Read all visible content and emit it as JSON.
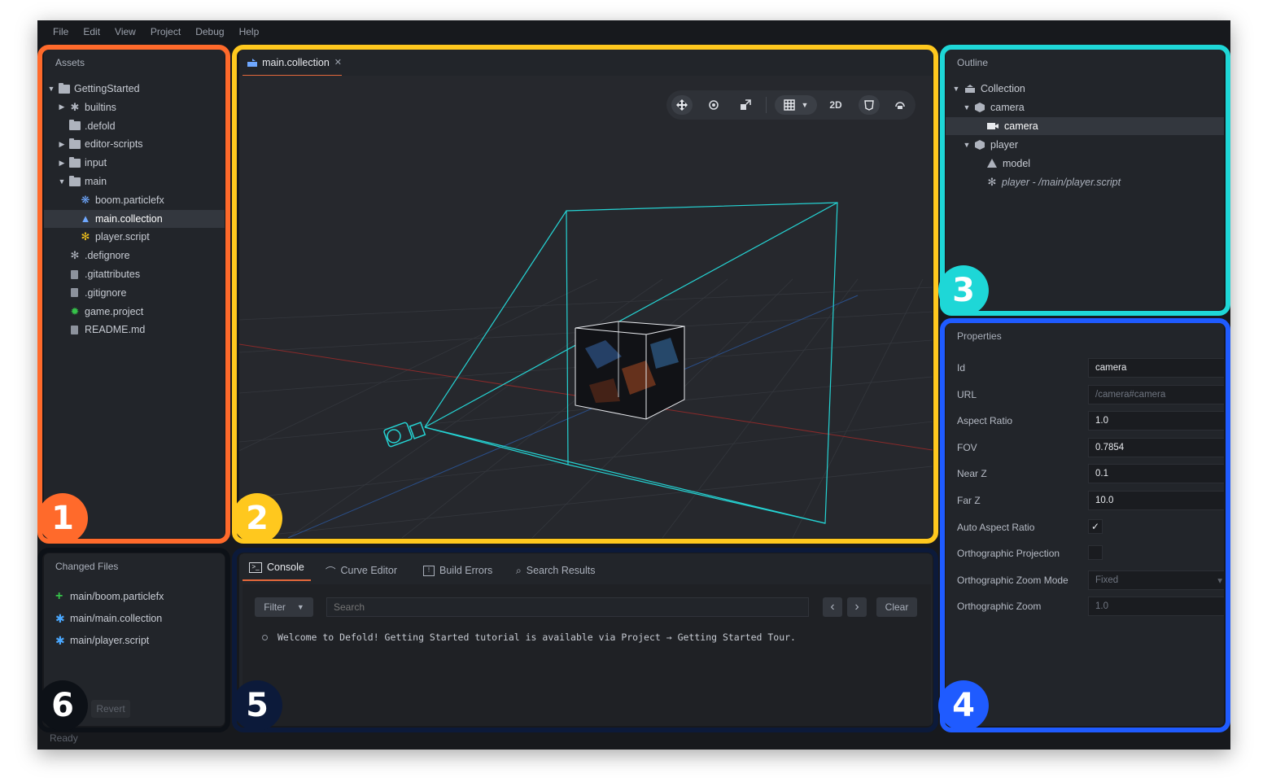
{
  "menu": [
    "File",
    "Edit",
    "View",
    "Project",
    "Debug",
    "Help"
  ],
  "assets": {
    "title": "Assets",
    "items": [
      {
        "label": "GettingStarted",
        "icon": "folder-icon",
        "toggle": "▼"
      },
      {
        "label": "builtins",
        "icon": "puzzle-icon",
        "toggle": "▶"
      },
      {
        "label": ".defold",
        "icon": "folder-icon",
        "toggle": ""
      },
      {
        "label": "editor-scripts",
        "icon": "folder-icon",
        "toggle": "▶"
      },
      {
        "label": "input",
        "icon": "folder-icon",
        "toggle": "▶"
      },
      {
        "label": "main",
        "icon": "folder-icon",
        "toggle": "▼"
      },
      {
        "label": "boom.particlefx",
        "icon": "particlefx-icon",
        "toggle": ""
      },
      {
        "label": "main.collection",
        "icon": "collection-icon",
        "toggle": ""
      },
      {
        "label": "player.script",
        "icon": "script-icon",
        "toggle": ""
      },
      {
        "label": ".defignore",
        "icon": "gear-icon",
        "toggle": ""
      },
      {
        "label": ".gitattributes",
        "icon": "file-icon",
        "toggle": ""
      },
      {
        "label": ".gitignore",
        "icon": "file-icon",
        "toggle": ""
      },
      {
        "label": "game.project",
        "icon": "project-gear-icon",
        "toggle": ""
      },
      {
        "label": "README.md",
        "icon": "file-icon",
        "toggle": ""
      }
    ]
  },
  "editor": {
    "tab_label": "main.collection",
    "tab_close": "✕",
    "toolbar": {
      "mode_2d": "2D"
    }
  },
  "outline": {
    "title": "Outline",
    "items": [
      {
        "label": "Collection",
        "toggle": "▼"
      },
      {
        "label": "camera",
        "toggle": "▼"
      },
      {
        "label": "camera",
        "toggle": ""
      },
      {
        "label": "player",
        "toggle": "▼"
      },
      {
        "label": "model",
        "toggle": ""
      },
      {
        "label": "player - /main/player.script",
        "toggle": ""
      }
    ]
  },
  "properties": {
    "title": "Properties",
    "rows": [
      {
        "label": "Id",
        "value": "camera",
        "readonly": false
      },
      {
        "label": "URL",
        "value": "/camera#camera",
        "readonly": true
      },
      {
        "label": "Aspect Ratio",
        "value": "1.0",
        "readonly": false
      },
      {
        "label": "FOV",
        "value": "0.7854",
        "readonly": false
      },
      {
        "label": "Near Z",
        "value": "0.1",
        "readonly": false
      },
      {
        "label": "Far Z",
        "value": "10.0",
        "readonly": false
      },
      {
        "label": "Auto Aspect Ratio",
        "value": "",
        "readonly": false
      },
      {
        "label": "Orthographic Projection",
        "value": "",
        "readonly": false
      },
      {
        "label": "Orthographic Zoom Mode",
        "value": "Fixed",
        "readonly": true
      },
      {
        "label": "Orthographic Zoom",
        "value": "1.0",
        "readonly": true
      }
    ],
    "auto_aspect_checked": true,
    "ortho_projection_checked": false
  },
  "console": {
    "tabs": [
      "Console",
      "Curve Editor",
      "Build Errors",
      "Search Results"
    ],
    "filter_label": "Filter",
    "search_placeholder": "Search",
    "clear_label": "Clear",
    "prev_glyph": "‹",
    "next_glyph": "›",
    "message": "Welcome to Defold! Getting Started tutorial is available via Project → Getting Started Tour."
  },
  "changed_files": {
    "title": "Changed Files",
    "items": [
      {
        "label": "main/boom.particlefx",
        "status": "added",
        "glyph": "+"
      },
      {
        "label": "main/main.collection",
        "status": "modified",
        "glyph": "✱"
      },
      {
        "label": "main/player.script",
        "status": "modified",
        "glyph": "✱"
      }
    ],
    "revert_label": "Revert"
  },
  "status_bar": "Ready",
  "callouts": [
    "1",
    "2",
    "3",
    "4",
    "5",
    "6"
  ],
  "colors": {
    "callout_1": "#ff6a2b",
    "callout_2": "#ffc81e",
    "callout_3": "#1ed7d7",
    "callout_4": "#1f5bff",
    "callout_5": "#0c1a3a",
    "callout_6": "#0d1117",
    "added": "#36c24a",
    "modified": "#4aa8ff",
    "accent_tab": "#e3683a",
    "camera_frustum": "#25d4d4"
  }
}
